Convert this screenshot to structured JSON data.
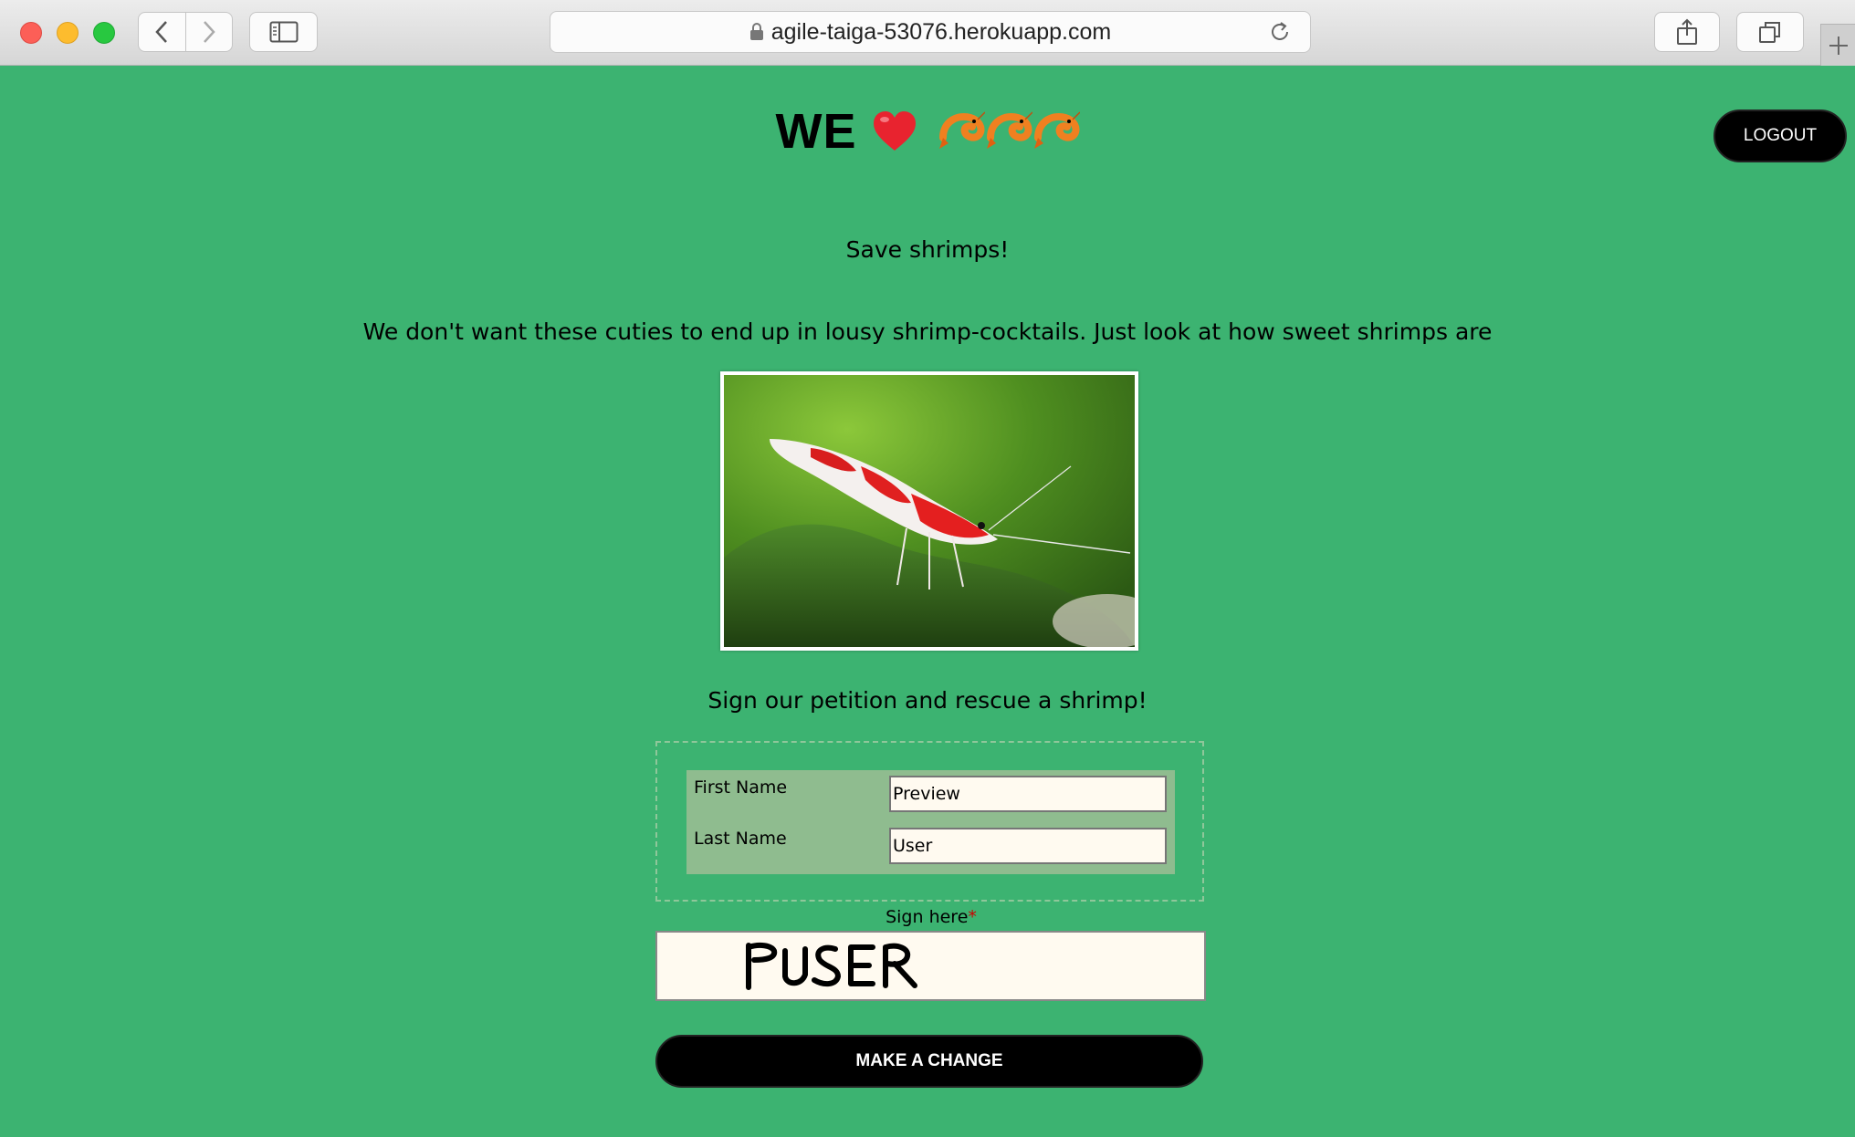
{
  "browser": {
    "url": "agile-taiga-53076.herokuapp.com"
  },
  "header": {
    "title_text": "WE",
    "heart_icon": "red-heart-emoji",
    "shrimp_icon": "shrimp-emoji",
    "shrimp_count": 3,
    "logout_label": "LOGOUT"
  },
  "main": {
    "subtitle": "Save shrimps!",
    "description": "We don't want these cuties to end up in lousy shrimp-cocktails. Just look at how sweet shrimps are",
    "photo": "red-cherry-shrimp-photo",
    "petition_prompt": "Sign our petition and rescue a shrimp!"
  },
  "form": {
    "first_name_label": "First Name",
    "first_name_value": "Preview",
    "last_name_label": "Last Name",
    "last_name_value": "User",
    "sign_label": "Sign here",
    "required_mark": "*",
    "signature_text": "PUSER",
    "submit_label": "MAKE A CHANGE"
  },
  "colors": {
    "page_background": "#3cb371",
    "form_inner_background": "#8fbc8f",
    "input_background": "#fffaf0",
    "button_background": "#000000"
  }
}
